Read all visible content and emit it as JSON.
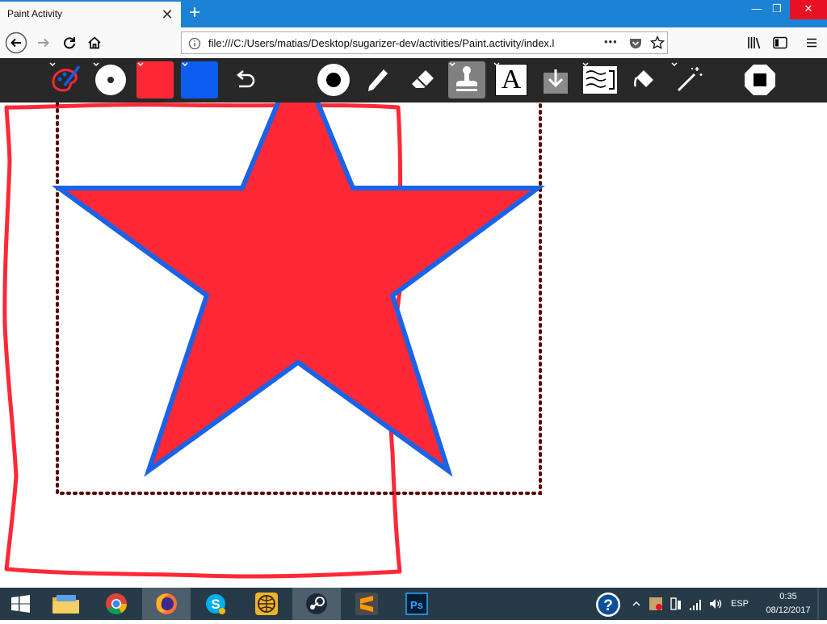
{
  "browser": {
    "tab_title": "Paint Activity",
    "tab_close": "✕",
    "new_tab": "+",
    "window_controls": {
      "minimize": "—",
      "restore": "❐",
      "close": "✕"
    },
    "url": "file:///C:/Users/matias/Desktop/sugarizer-dev/activities/Paint.activity/index.l",
    "url_menu": "•••"
  },
  "toolbar": {
    "color_red": "#ff2836",
    "color_blue": "#0d5ef0",
    "tools": [
      "activity-icon",
      "size-icon",
      "color-red",
      "color-blue",
      "undo-icon",
      "brush-size-icon",
      "pencil-icon",
      "eraser-icon",
      "stamp-icon",
      "text-icon",
      "insert-image-icon",
      "background-icon",
      "bucket-icon",
      "filters-icon",
      "stop-icon"
    ],
    "text_tool_glyph": "A"
  },
  "canvas": {
    "star_fill": "#ff2836",
    "star_stroke": "#1a63e6",
    "outline_color": "#ff2836",
    "selection_color": "#5a0000"
  },
  "taskbar": {
    "language": "ESP",
    "time": "0:35",
    "date": "08/12/2017"
  }
}
